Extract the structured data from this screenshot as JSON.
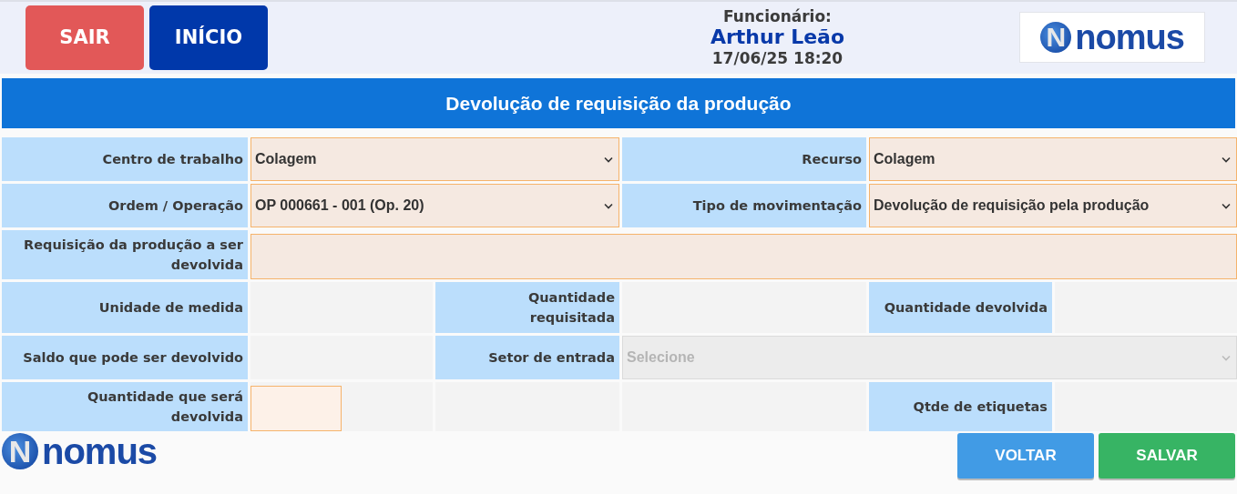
{
  "header": {
    "buttons": [
      {
        "label": "SAIR",
        "kind": "danger"
      },
      {
        "label": "INÍCIO",
        "kind": "primary"
      }
    ],
    "employee_label": "Funcionário:",
    "employee_name": "Arthur Leão",
    "datetime": "17/06/25 18:20",
    "logo": {
      "mark": "N",
      "text": "nomus"
    }
  },
  "title": "Devolução de requisição da produção",
  "form": {
    "rows": [
      [
        {
          "kind": "label",
          "text": "Centro de trabalho"
        },
        {
          "kind": "select",
          "value": "Colagem",
          "disabled": false
        },
        {
          "kind": "label",
          "text": "Recurso"
        },
        {
          "kind": "select",
          "value": "Colagem",
          "disabled": false
        }
      ],
      [
        {
          "kind": "label",
          "text": "Ordem / Operação"
        },
        {
          "kind": "select",
          "value": "OP 000661 - 001 (Op. 20)",
          "disabled": false
        },
        {
          "kind": "label",
          "text": "Tipo de movimentação"
        },
        {
          "kind": "select",
          "value": "Devolução de requisição pela produção",
          "disabled": false
        }
      ],
      [
        {
          "kind": "label",
          "text": "Requisição da produção a ser devolvida"
        },
        {
          "kind": "textarea"
        }
      ],
      [
        {
          "kind": "label",
          "text": "Unidade de medida"
        },
        {
          "kind": "empty"
        },
        {
          "kind": "label",
          "text": "Quantidade requisitada"
        },
        {
          "kind": "empty"
        },
        {
          "kind": "label",
          "text": "Quantidade devolvida"
        },
        {
          "kind": "empty"
        }
      ],
      [
        {
          "kind": "label",
          "text": "Saldo que pode ser devolvido"
        },
        {
          "kind": "empty"
        },
        {
          "kind": "label",
          "text": "Setor de entrada"
        },
        {
          "kind": "select",
          "value": "Selecione",
          "disabled": true
        }
      ],
      [
        {
          "kind": "label",
          "text": "Quantidade que será devolvida"
        },
        {
          "kind": "input"
        },
        {
          "kind": "empty"
        },
        {
          "kind": "empty"
        },
        {
          "kind": "label",
          "text": "Qtde de etiquetas"
        },
        {
          "kind": "empty"
        }
      ]
    ]
  },
  "footer": {
    "logo": {
      "mark": "N",
      "text": "nomus"
    },
    "buttons": [
      {
        "label": "VOLTAR",
        "kind": "info"
      },
      {
        "label": "SALVAR",
        "kind": "success"
      }
    ]
  }
}
